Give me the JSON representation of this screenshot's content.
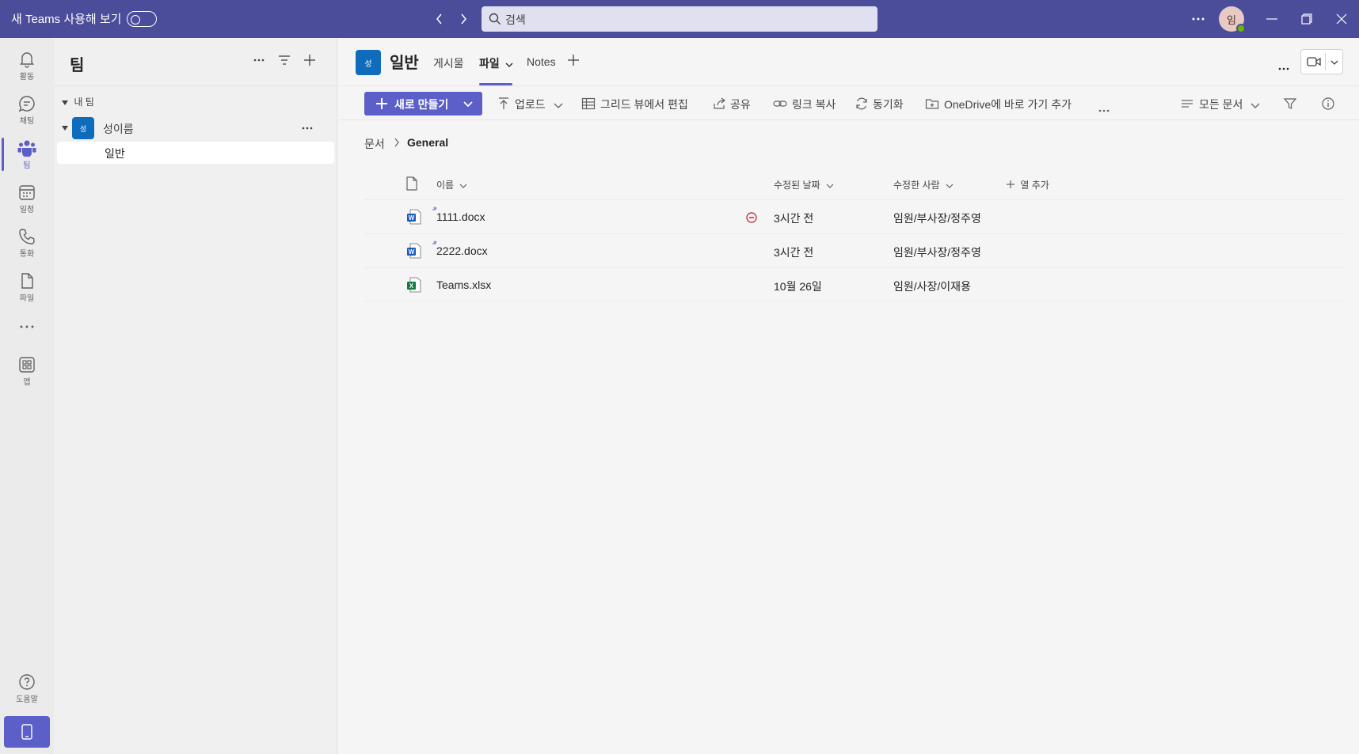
{
  "titlebar": {
    "new_teams_label": "새 Teams 사용해 보기",
    "search_placeholder": "검색",
    "avatar_initial": "임"
  },
  "rail": {
    "items": [
      {
        "label": "활동",
        "icon": "bell-icon"
      },
      {
        "label": "채팅",
        "icon": "chat-icon"
      },
      {
        "label": "팀",
        "icon": "teams-icon"
      },
      {
        "label": "일정",
        "icon": "calendar-icon"
      },
      {
        "label": "통화",
        "icon": "phone-icon"
      },
      {
        "label": "파일",
        "icon": "file-icon"
      },
      {
        "label": "",
        "icon": "more-icon"
      },
      {
        "label": "앱",
        "icon": "apps-icon"
      }
    ],
    "help_label": "도움말"
  },
  "teams_pane": {
    "title": "팀",
    "section_label": "내 팀",
    "team": {
      "initial": "성",
      "name": "성이름"
    },
    "channel": "일반"
  },
  "channel_header": {
    "tile_initial": "성",
    "title": "일반",
    "tabs": [
      "게시물",
      "파일",
      "Notes"
    ],
    "active_tab": "파일"
  },
  "command_bar": {
    "new_label": "새로 만들기",
    "upload": "업로드",
    "grid_edit": "그리드 뷰에서 편집",
    "share": "공유",
    "copy_link": "링크 복사",
    "sync": "동기화",
    "onedrive_shortcut": "OneDrive에 바로 가기 추가",
    "view": "모든 문서"
  },
  "breadcrumb": {
    "root": "문서",
    "current": "General"
  },
  "files": {
    "columns": {
      "name": "이름",
      "modified": "수정된 날짜",
      "modified_by": "수정한 사람",
      "add_column": "열 추가"
    },
    "rows": [
      {
        "name": "1111.docx",
        "type": "word",
        "modified": "3시간 전",
        "modified_by": "임원/부사장/정주영",
        "blocked": true
      },
      {
        "name": "2222.docx",
        "type": "word",
        "modified": "3시간 전",
        "modified_by": "임원/부사장/정주영",
        "blocked": false
      },
      {
        "name": "Teams.xlsx",
        "type": "excel",
        "modified": "10월 26일",
        "modified_by": "임원/사장/이재용",
        "blocked": false
      }
    ]
  },
  "colors": {
    "titlebar": "#4b4c9a",
    "accent": "#5b5fc7",
    "team_tile": "#0f6cbd",
    "word": "#185abd",
    "excel": "#107c41",
    "blocked": "#c50f1f"
  }
}
